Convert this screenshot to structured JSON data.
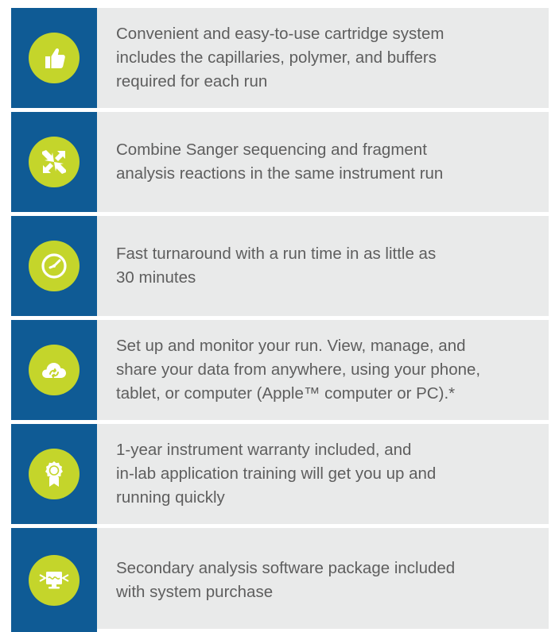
{
  "theme": {
    "sidebar_color": "#0f5b95",
    "icon_circle_color": "#c4d52b",
    "row_background": "#e9eaea",
    "text_color": "#5e5e5e"
  },
  "features": [
    {
      "icon": "thumbs-up-icon",
      "text": "Convenient and easy-to-use cartridge system\nincludes the capillaries, polymer, and buffers\nrequired for each run"
    },
    {
      "icon": "combine-arrows-icon",
      "text": "Combine Sanger sequencing and fragment\nanalysis reactions in the same instrument run"
    },
    {
      "icon": "clock-icon",
      "text": "Fast turnaround with a run time in as little as\n30 minutes"
    },
    {
      "icon": "cloud-sync-icon",
      "text": "Set up and monitor your run. View, manage, and\nshare your data from anywhere, using your phone,\ntablet, or computer (Apple™ computer or PC).*"
    },
    {
      "icon": "award-ribbon-icon",
      "text": "1-year instrument warranty included, and\nin-lab application training will get you up and\nrunning quickly"
    },
    {
      "icon": "analysis-monitor-icon",
      "text": "Secondary analysis software package included\nwith system purchase"
    }
  ]
}
